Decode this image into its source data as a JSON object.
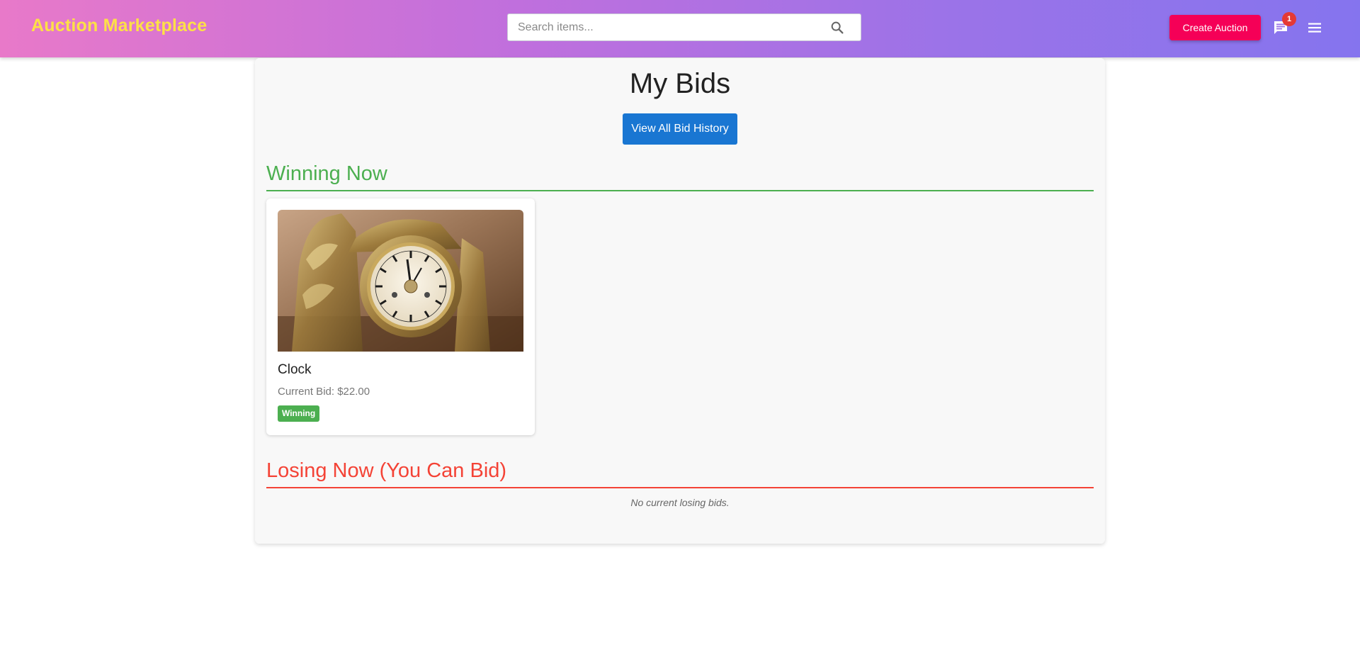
{
  "header": {
    "brand": "Auction Marketplace",
    "search_placeholder": "Search items...",
    "search_value": "",
    "create_label": "Create Auction",
    "messages_badge": "1"
  },
  "main": {
    "title": "My Bids",
    "history_button": "View All Bid History",
    "winning_heading": "Winning Now",
    "winning_items": [
      {
        "name": "Clock",
        "bid_text": "Current Bid: $22.00",
        "status": "Winning"
      }
    ],
    "losing_heading": "Losing Now (You Can Bid)",
    "losing_empty": "No current losing bids."
  },
  "colors": {
    "brand_text": "#fde047",
    "create_button": "#f50057",
    "primary_button": "#1976d2",
    "winning": "#4caf50",
    "losing": "#f44336",
    "badge": "#e53935"
  },
  "icons": {
    "search": "search-icon",
    "messages": "chat-icon",
    "menu": "hamburger-menu-icon"
  }
}
